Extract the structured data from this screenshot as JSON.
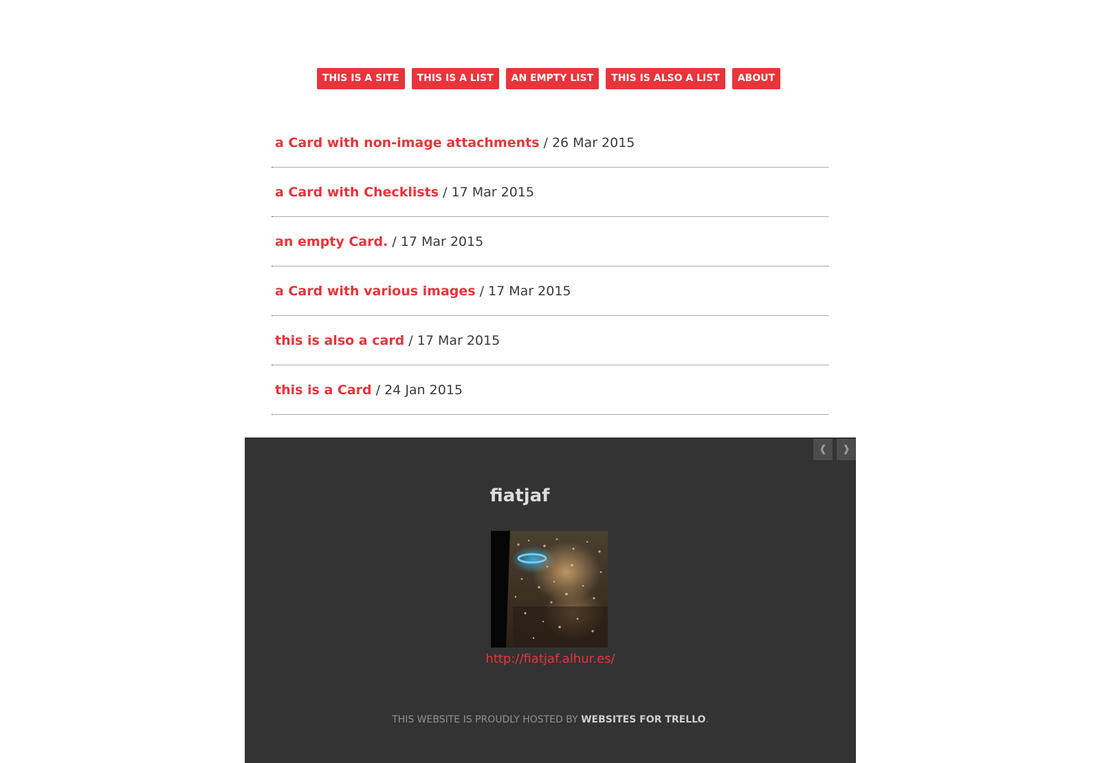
{
  "nav": {
    "items": [
      {
        "label": "THIS IS A SITE"
      },
      {
        "label": "THIS IS A LIST"
      },
      {
        "label": "AN EMPTY LIST"
      },
      {
        "label": "THIS IS ALSO A LIST"
      },
      {
        "label": "ABOUT"
      }
    ]
  },
  "cards": [
    {
      "title": "a Card with non-image attachments",
      "date": "/ 26 Mar 2015"
    },
    {
      "title": "a Card with Checklists",
      "date": "/ 17 Mar 2015"
    },
    {
      "title": "an empty Card.",
      "date": "/ 17 Mar 2015"
    },
    {
      "title": "a Card with various images",
      "date": "/ 17 Mar 2015"
    },
    {
      "title": "this is also a card",
      "date": "/ 17 Mar 2015"
    },
    {
      "title": "this is a Card",
      "date": "/ 24 Jan 2015"
    }
  ],
  "pager": {
    "prev": "❰",
    "next": "❱"
  },
  "profile": {
    "name": "fiatjaf",
    "link": "http://fiatjaf.alhur.es/"
  },
  "footer": {
    "hosted_prefix": "THIS WEBSITE IS PROUDLY HOSTED BY ",
    "hosted_link": "WEBSITES FOR TRELLO",
    "hosted_suffix": "."
  },
  "colors": {
    "accent": "#e8343a",
    "footer_bg": "#333333"
  }
}
